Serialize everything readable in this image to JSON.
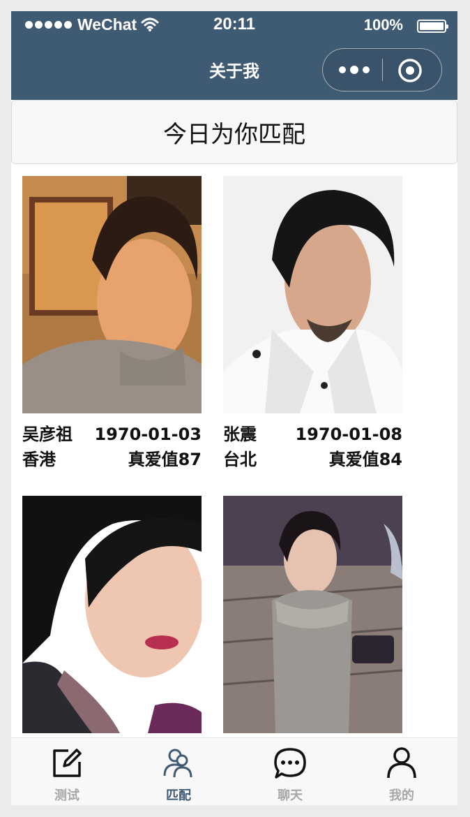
{
  "status_bar": {
    "carrier": "WeChat",
    "time": "20:11",
    "battery": "100%"
  },
  "nav": {
    "title": "关于我"
  },
  "match_bar": {
    "label": "今日为你匹配"
  },
  "cards": [
    {
      "name": "吴彦祖",
      "date": "1970-01-03",
      "city": "香港",
      "score": "真爱值87"
    },
    {
      "name": "张震",
      "date": "1970-01-08",
      "city": "台北",
      "score": "真爱值84"
    },
    {
      "name": "",
      "date": "",
      "city": "",
      "score": ""
    },
    {
      "name": "",
      "date": "",
      "city": "",
      "score": ""
    }
  ],
  "tabs": [
    {
      "label": "测试",
      "icon": "edit-icon"
    },
    {
      "label": "匹配",
      "icon": "users-icon",
      "active": true
    },
    {
      "label": "聊天",
      "icon": "chat-icon"
    },
    {
      "label": "我的",
      "icon": "user-icon"
    }
  ],
  "colors": {
    "nav_bg": "#3f5a73",
    "tab_active": "#3f5a73",
    "tab_inactive": "#a7a7a7"
  }
}
